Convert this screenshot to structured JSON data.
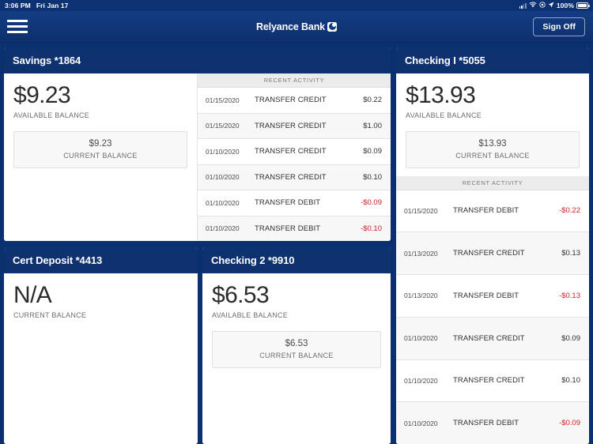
{
  "statusbar": {
    "time": "3:06 PM",
    "date": "Fri Jan 17",
    "battery_percent": "100%",
    "icons": [
      "signal-icon",
      "wifi-icon",
      "do-not-disturb-icon",
      "location-arrow-icon",
      "battery-icon"
    ]
  },
  "header": {
    "menu_icon": "hamburger-menu-icon",
    "brand": "Relyance Bank",
    "brand_mark": "relyance-logo-icon",
    "signoff_label": "Sign Off"
  },
  "activity_header": "RECENT ACTIVITY",
  "labels": {
    "available_balance": "AVAILABLE BALANCE",
    "current_balance": "CURRENT BALANCE"
  },
  "colors": {
    "navy": "#0e3270",
    "header_navy": "#143d82",
    "debit_red": "#cc2027",
    "row_alt": "#f7f7f7",
    "box_gray": "#f8f8f8"
  },
  "accounts": [
    {
      "title": "Savings *1864",
      "available_balance": "$9.23",
      "current_balance": "$9.23",
      "activity": [
        {
          "date": "01/15/2020",
          "description": "TRANSFER CREDIT",
          "amount": "$0.22",
          "negative": false
        },
        {
          "date": "01/15/2020",
          "description": "TRANSFER CREDIT",
          "amount": "$1.00",
          "negative": false
        },
        {
          "date": "01/10/2020",
          "description": "TRANSFER CREDIT",
          "amount": "$0.09",
          "negative": false
        },
        {
          "date": "01/10/2020",
          "description": "TRANSFER CREDIT",
          "amount": "$0.10",
          "negative": false
        },
        {
          "date": "01/10/2020",
          "description": "TRANSFER DEBIT",
          "amount": "-$0.09",
          "negative": true
        },
        {
          "date": "01/10/2020",
          "description": "TRANSFER DEBIT",
          "amount": "-$0.10",
          "negative": true
        }
      ]
    },
    {
      "title": "Cert Deposit *4413",
      "available_balance": "N/A",
      "available_label": "CURRENT BALANCE",
      "current_balance": null,
      "activity": []
    },
    {
      "title": "Checking 2 *9910",
      "available_balance": "$6.53",
      "current_balance": "$6.53",
      "activity": []
    },
    {
      "title": "Checking I *5055",
      "available_balance": "$13.93",
      "current_balance": "$13.93",
      "activity": [
        {
          "date": "01/15/2020",
          "description": "TRANSFER DEBIT",
          "amount": "-$0.22",
          "negative": true
        },
        {
          "date": "01/13/2020",
          "description": "TRANSFER CREDIT",
          "amount": "$0.13",
          "negative": false
        },
        {
          "date": "01/13/2020",
          "description": "TRANSFER DEBIT",
          "amount": "-$0.13",
          "negative": true
        },
        {
          "date": "01/10/2020",
          "description": "TRANSFER CREDIT",
          "amount": "$0.09",
          "negative": false
        },
        {
          "date": "01/10/2020",
          "description": "TRANSFER CREDIT",
          "amount": "$0.10",
          "negative": false
        },
        {
          "date": "01/10/2020",
          "description": "TRANSFER DEBIT",
          "amount": "-$0.09",
          "negative": true
        }
      ]
    }
  ]
}
